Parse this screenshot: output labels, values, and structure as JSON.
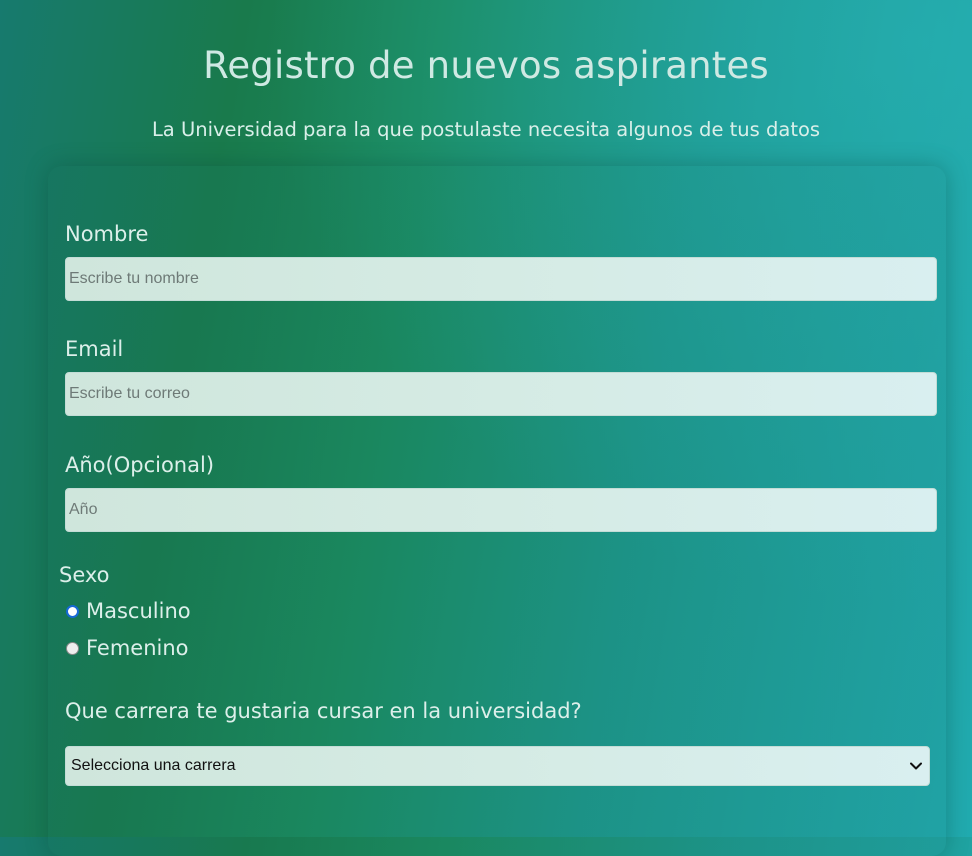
{
  "header": {
    "title": "Registro de nuevos aspirantes",
    "subtitle": "La Universidad para la que postulaste necesita algunos de tus datos"
  },
  "form": {
    "name": {
      "label": "Nombre",
      "value": "",
      "placeholder": "Escribe tu nombre"
    },
    "email": {
      "label": "Email",
      "value": "",
      "placeholder": "Escribe tu correo"
    },
    "year": {
      "label": "Año(Opcional)",
      "value": "",
      "placeholder": "Año"
    },
    "sex": {
      "label": "Sexo",
      "options": [
        {
          "label": "Masculino",
          "checked": true
        },
        {
          "label": "Femenino",
          "checked": false
        }
      ]
    },
    "career": {
      "label": "Que carrera te gustaria cursar en la universidad?",
      "selected": "Selecciona una carrera",
      "icon": "chevron-down-icon"
    }
  },
  "colors": {
    "radio_checked": "#1769d6"
  }
}
